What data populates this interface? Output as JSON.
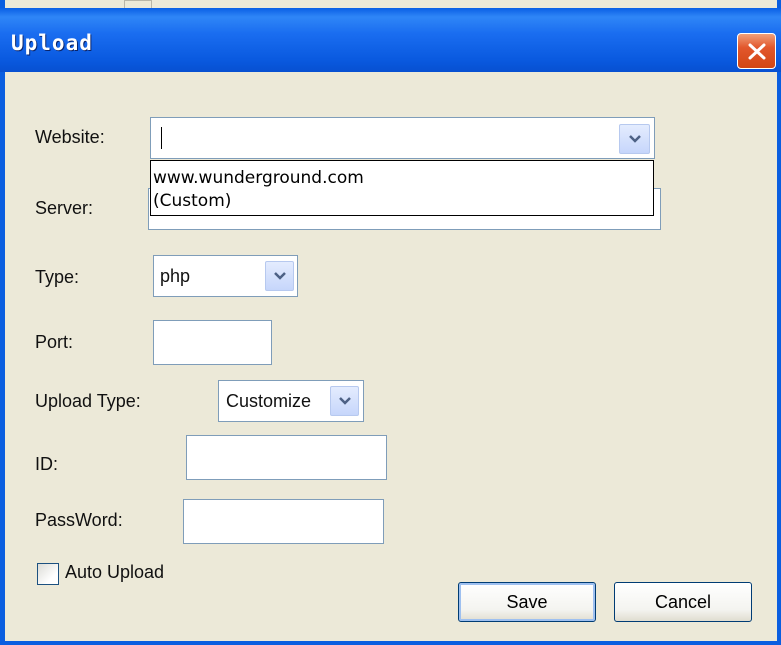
{
  "dialog": {
    "title": "Upload",
    "close_icon": "close-icon"
  },
  "fields": {
    "website_label": "Website:",
    "website_value": "",
    "website_options": [
      "www.wunderground.com",
      "(Custom)"
    ],
    "server_label": "Server:",
    "server_value": "",
    "type_label": "Type:",
    "type_value": "php",
    "port_label": "Port:",
    "port_value": "",
    "upload_type_label": "Upload Type:",
    "upload_type_value": "Customize",
    "id_label": "ID:",
    "id_value": "",
    "password_label": "PassWord:",
    "password_value": ""
  },
  "auto_upload": {
    "label": "Auto Upload",
    "checked": false
  },
  "buttons": {
    "save": "Save",
    "cancel": "Cancel"
  },
  "colors": {
    "titlebar": "#0a5ee0",
    "face": "#ece9d8",
    "close_button": "#e2572c"
  }
}
